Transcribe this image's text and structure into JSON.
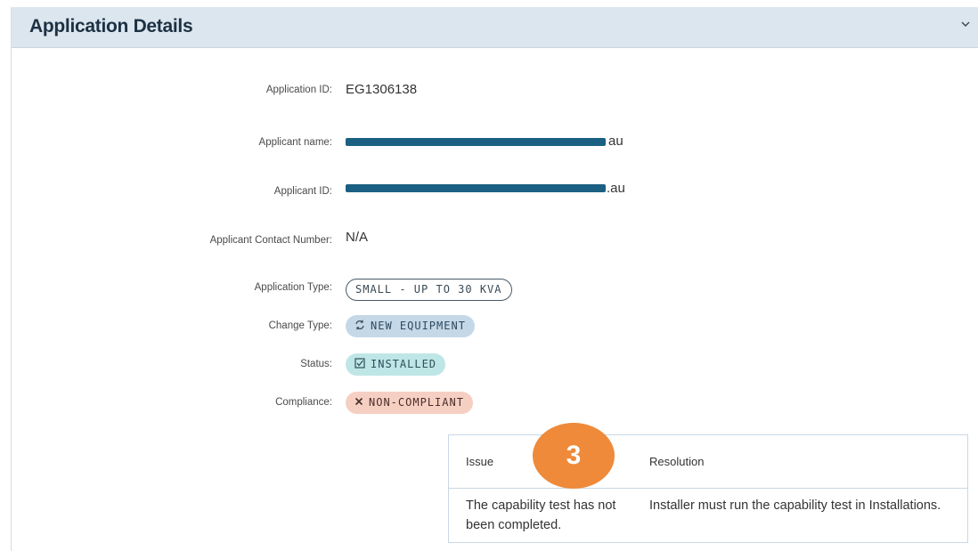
{
  "panel": {
    "title": "Application Details",
    "chevron_icon": "chevron-down-icon"
  },
  "fields": {
    "application_id": {
      "label": "Application ID:",
      "value": "EG1306138"
    },
    "applicant_name": {
      "label": "Applicant name:",
      "value_suffix": "au"
    },
    "applicant_id": {
      "label": "Applicant ID:",
      "value_suffix": ".au"
    },
    "contact_number": {
      "label": "Applicant Contact Number:",
      "value": "N/A"
    },
    "application_type": {
      "label": "Application Type:",
      "value": "SMALL - UP TO 30 KVA"
    },
    "change_type": {
      "label": "Change Type:",
      "value": "NEW EQUIPMENT",
      "icon": "refresh-icon"
    },
    "status": {
      "label": "Status:",
      "value": "INSTALLED",
      "icon": "checkbox-icon"
    },
    "compliance": {
      "label": "Compliance:",
      "value": "NON-COMPLIANT",
      "icon": "x-icon"
    }
  },
  "issues_table": {
    "headers": {
      "issue": "Issue",
      "resolution": "Resolution"
    },
    "rows": [
      {
        "issue": "The capability test has not been completed.",
        "resolution": "Installer must run the capability test in Installations."
      }
    ]
  },
  "step_badge": {
    "number": "3"
  },
  "colors": {
    "header_bg": "#dce6ef",
    "redaction": "#1b5f82",
    "badge": "#ee8a3a",
    "pill_blue": "#c5d8e8",
    "pill_teal": "#bfe6e6",
    "pill_red": "#f6cfc3"
  }
}
